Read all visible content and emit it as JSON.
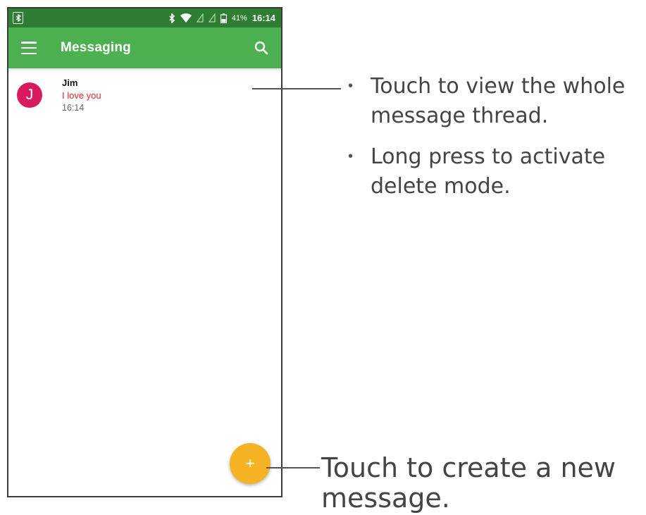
{
  "status_bar": {
    "battery_percent": "41%",
    "time": "16:14",
    "icons": [
      "bluetooth-icon",
      "wifi-icon",
      "no-sim-icon",
      "battery-icon"
    ]
  },
  "app_bar": {
    "title": "Messaging",
    "color": "#4caf50",
    "status_color": "#2e7d32"
  },
  "conversations": [
    {
      "avatar_letter": "J",
      "name": "Jim",
      "snippet": "I love you",
      "time": "16:14",
      "avatar_color": "#d81b60"
    }
  ],
  "fab": {
    "label": "+",
    "color": "#f5b323"
  },
  "annotations": {
    "bullet_1_line1": "Touch to view the whole",
    "bullet_1_line2": "message thread.",
    "bullet_2_line1": "Long press to activate",
    "bullet_2_line2": "delete mode.",
    "fab_line1": "Touch to create a new",
    "fab_line2": "message."
  }
}
